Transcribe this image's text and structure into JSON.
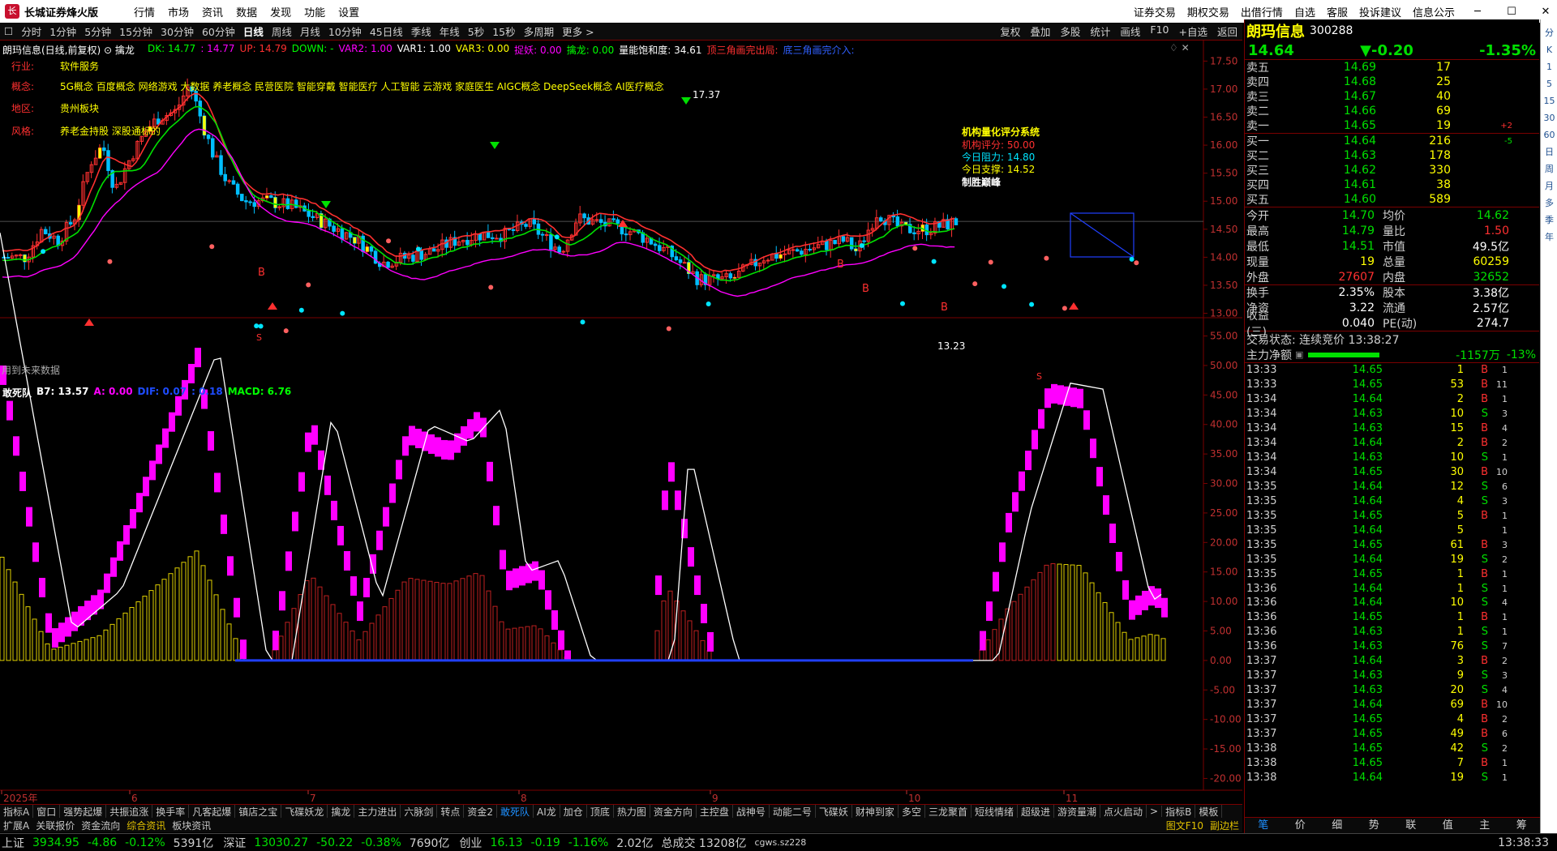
{
  "app": {
    "title": "长城证券烽火版",
    "menu": [
      "行情",
      "市场",
      "资讯",
      "数据",
      "发现",
      "功能",
      "设置"
    ],
    "right_menu": [
      "证券交易",
      "期权交易",
      "出借行情",
      "自选",
      "客服",
      "投诉建议",
      "信息公示"
    ]
  },
  "periods": [
    "分时",
    "1分钟",
    "5分钟",
    "15分钟",
    "30分钟",
    "60分钟",
    "日线",
    "周线",
    "月线",
    "10分钟",
    "45日线",
    "季线",
    "年线",
    "5秒",
    "15秒",
    "多周期",
    "更多 >"
  ],
  "active_period": "日线",
  "toolbar": [
    "复权",
    "叠加",
    "多股",
    "统计",
    "画线",
    "F10",
    "+自选",
    "返回"
  ],
  "main_indicator": {
    "name_line": "朗玛信息(日线,前复权) ⊙ 擒龙",
    "vals": [
      {
        "t": "DK: 14.77",
        "c": "#00ff00"
      },
      {
        "t": ": 14.77",
        "c": "#ff00ff"
      },
      {
        "t": "UP: 14.79",
        "c": "#ff3030"
      },
      {
        "t": "DOWN: -",
        "c": "#00ff00"
      },
      {
        "t": "VAR2: 1.00",
        "c": "#ff00ff"
      },
      {
        "t": "VAR1: 1.00",
        "c": "#ffffff"
      },
      {
        "t": "VAR3: 0.00",
        "c": "#ffff00"
      },
      {
        "t": "捉妖: 0.00",
        "c": "#ff00ff"
      },
      {
        "t": "擒龙: 0.00",
        "c": "#00ff00"
      },
      {
        "t": "量能饱和度: 34.61",
        "c": "#ffffff"
      },
      {
        "t": "顶三角画完出局:",
        "c": "#ff3030"
      },
      {
        "t": "底三角画完介入:",
        "c": "#3060ff"
      }
    ]
  },
  "info": {
    "industry_label": "行业:",
    "industry": "软件服务",
    "concept_label": "概念:",
    "concepts": "5G概念 百度概念 网络游戏 大数据 养老概念 民营医院 智能穿戴 智能医疗 人工智能 云游戏 家庭医生 AIGC概念 DeepSeek概念 AI医疗概念",
    "region_label": "地区:",
    "region": "贵州板块",
    "style_label": "风格:",
    "style": "养老金持股 深股通标的"
  },
  "quant": {
    "title": "机构量化评分系统",
    "score": "机构评分: 50.00",
    "resist": "今日阻力: 14.80",
    "support": "今日支撑: 14.52",
    "note": "制胜巅峰"
  },
  "price_labels": {
    "high": "17.37",
    "low": "13.23"
  },
  "future_note": "用到未来数据",
  "y_axis_main": [
    "17.50",
    "17.00",
    "16.50",
    "16.00",
    "15.50",
    "15.00",
    "14.50",
    "14.00",
    "13.50",
    "13.00"
  ],
  "sub_indicator": {
    "vals": [
      {
        "t": "敢死队",
        "c": "#ffffff"
      },
      {
        "t": "B7: 13.57",
        "c": "#ffffff"
      },
      {
        "t": "A: 0.00",
        "c": "#ff00ff"
      },
      {
        "t": "DIF: 0.07",
        "c": "#1e4cff"
      },
      {
        "t": ": 0.18",
        "c": "#1e4cff"
      },
      {
        "t": "MACD: 6.76",
        "c": "#00ff00"
      }
    ]
  },
  "y_axis_sub": [
    "55.00",
    "50.00",
    "45.00",
    "40.00",
    "35.00",
    "30.00",
    "25.00",
    "20.00",
    "15.00",
    "10.00",
    "5.00",
    "0.00",
    "-5.00",
    "-10.00",
    "-15.00",
    "-20.00"
  ],
  "x_axis": [
    {
      "t": "2025年"
    },
    {
      "t": "6"
    },
    {
      "t": "7"
    },
    {
      "t": "8"
    },
    {
      "t": "9"
    },
    {
      "t": "10"
    },
    {
      "t": "11"
    }
  ],
  "x_axis_right": "日线",
  "bottom_tabs": [
    "指标A",
    "窗口",
    "强势起爆",
    "共振追涨",
    "换手率",
    "凡客起爆",
    "镇店之宝",
    "飞碟妖龙",
    "擒龙",
    "主力进出",
    "六脉剑",
    "转点",
    "资金2",
    "敢死队",
    "AI龙",
    "加仓",
    "顶底",
    "热力图",
    "资金方向",
    "主控盘",
    "战神号",
    "动能二号",
    "飞碟妖",
    "财神到家",
    "多空",
    "三龙聚首",
    "短线情绪",
    "超级进",
    "游资量潮",
    "点火启动",
    ">",
    "指标B",
    "模板"
  ],
  "active_bottom_tab": "敢死队",
  "bottom_tabs2": [
    "扩展A",
    "关联报价",
    "资金流向",
    "综合资讯",
    "板块资讯"
  ],
  "bottom_tabs2_right": [
    "图文F10",
    "副边栏"
  ],
  "stock": {
    "name": "朗玛信息",
    "code": "300288",
    "price": "14.64",
    "change": "▼-0.20",
    "pct": "-1.35%"
  },
  "orderbook": {
    "asks": [
      {
        "l": "卖五",
        "p": "14.69",
        "v": "17",
        "c": ""
      },
      {
        "l": "卖四",
        "p": "14.68",
        "v": "25",
        "c": ""
      },
      {
        "l": "卖三",
        "p": "14.67",
        "v": "40",
        "c": ""
      },
      {
        "l": "卖二",
        "p": "14.66",
        "v": "69",
        "c": ""
      },
      {
        "l": "卖一",
        "p": "14.65",
        "v": "19",
        "c": "+2"
      }
    ],
    "bids": [
      {
        "l": "买一",
        "p": "14.64",
        "v": "216",
        "c": "-5"
      },
      {
        "l": "买二",
        "p": "14.63",
        "v": "178",
        "c": ""
      },
      {
        "l": "买三",
        "p": "14.62",
        "v": "330",
        "c": ""
      },
      {
        "l": "买四",
        "p": "14.61",
        "v": "38",
        "c": ""
      },
      {
        "l": "买五",
        "p": "14.60",
        "v": "589",
        "c": ""
      }
    ]
  },
  "stats": [
    {
      "k": "今开",
      "v": "14.70",
      "vc": "#00e000",
      "k2": "均价",
      "v2": "14.62",
      "v2c": "#00e000"
    },
    {
      "k": "最高",
      "v": "14.79",
      "vc": "#00e000",
      "k2": "量比",
      "v2": "1.50",
      "v2c": "#ff3030"
    },
    {
      "k": "最低",
      "v": "14.51",
      "vc": "#00e000",
      "k2": "市值",
      "v2": "49.5亿",
      "v2c": "#ffffff"
    },
    {
      "k": "现量",
      "v": "19",
      "vc": "#ffff00",
      "k2": "总量",
      "v2": "60259",
      "v2c": "#ffff00"
    },
    {
      "k": "外盘",
      "v": "27607",
      "vc": "#ff3030",
      "k2": "内盘",
      "v2": "32652",
      "v2c": "#00e000"
    },
    {
      "k": "换手",
      "v": "2.35%",
      "vc": "#ffffff",
      "k2": "股本",
      "v2": "3.38亿",
      "v2c": "#ffffff"
    },
    {
      "k": "净资",
      "v": "3.22",
      "vc": "#ffffff",
      "k2": "流通",
      "v2": "2.57亿",
      "v2c": "#ffffff"
    },
    {
      "k": "收益(三)",
      "v": "0.040",
      "vc": "#ffffff",
      "k2": "PE(动)",
      "v2": "274.7",
      "v2c": "#ffffff"
    }
  ],
  "trade_status": "交易状态: 连续竞价 13:38:27",
  "main_flow": {
    "label": "主力净额",
    "value": "-1157万",
    "pct": "-13%"
  },
  "ticks": [
    {
      "t": "13:33",
      "p": "14.65",
      "v": "1",
      "s": "B",
      "n": "1"
    },
    {
      "t": "13:33",
      "p": "14.65",
      "v": "53",
      "s": "B",
      "n": "11"
    },
    {
      "t": "13:34",
      "p": "14.64",
      "v": "2",
      "s": "B",
      "n": "1"
    },
    {
      "t": "13:34",
      "p": "14.63",
      "v": "10",
      "s": "S",
      "n": "3"
    },
    {
      "t": "13:34",
      "p": "14.63",
      "v": "15",
      "s": "B",
      "n": "4"
    },
    {
      "t": "13:34",
      "p": "14.64",
      "v": "2",
      "s": "B",
      "n": "2"
    },
    {
      "t": "13:34",
      "p": "14.63",
      "v": "10",
      "s": "S",
      "n": "1"
    },
    {
      "t": "13:34",
      "p": "14.65",
      "v": "30",
      "s": "B",
      "n": "10"
    },
    {
      "t": "13:35",
      "p": "14.64",
      "v": "12",
      "s": "S",
      "n": "6"
    },
    {
      "t": "13:35",
      "p": "14.64",
      "v": "4",
      "s": "S",
      "n": "3"
    },
    {
      "t": "13:35",
      "p": "14.65",
      "v": "5",
      "s": "B",
      "n": "1"
    },
    {
      "t": "13:35",
      "p": "14.64",
      "v": "5",
      "s": "",
      "n": "1"
    },
    {
      "t": "13:35",
      "p": "14.65",
      "v": "61",
      "s": "B",
      "n": "3"
    },
    {
      "t": "13:35",
      "p": "14.64",
      "v": "19",
      "s": "S",
      "n": "2"
    },
    {
      "t": "13:35",
      "p": "14.65",
      "v": "1",
      "s": "B",
      "n": "1"
    },
    {
      "t": "13:36",
      "p": "14.64",
      "v": "1",
      "s": "S",
      "n": "1"
    },
    {
      "t": "13:36",
      "p": "14.64",
      "v": "10",
      "s": "S",
      "n": "4"
    },
    {
      "t": "13:36",
      "p": "14.65",
      "v": "1",
      "s": "B",
      "n": "1"
    },
    {
      "t": "13:36",
      "p": "14.63",
      "v": "1",
      "s": "S",
      "n": "1"
    },
    {
      "t": "13:36",
      "p": "14.63",
      "v": "76",
      "s": "S",
      "n": "7"
    },
    {
      "t": "13:37",
      "p": "14.64",
      "v": "3",
      "s": "B",
      "n": "2"
    },
    {
      "t": "13:37",
      "p": "14.63",
      "v": "9",
      "s": "S",
      "n": "3"
    },
    {
      "t": "13:37",
      "p": "14.63",
      "v": "20",
      "s": "S",
      "n": "4"
    },
    {
      "t": "13:37",
      "p": "14.64",
      "v": "69",
      "s": "B",
      "n": "10"
    },
    {
      "t": "13:37",
      "p": "14.65",
      "v": "4",
      "s": "B",
      "n": "2"
    },
    {
      "t": "13:37",
      "p": "14.65",
      "v": "49",
      "s": "B",
      "n": "6"
    },
    {
      "t": "13:38",
      "p": "14.65",
      "v": "42",
      "s": "S",
      "n": "2"
    },
    {
      "t": "13:38",
      "p": "14.65",
      "v": "7",
      "s": "B",
      "n": "1"
    },
    {
      "t": "13:38",
      "p": "14.64",
      "v": "19",
      "s": "S",
      "n": "1"
    }
  ],
  "right_tabs": [
    "笔",
    "价",
    "细",
    "势",
    "联",
    "值",
    "主",
    "筹"
  ],
  "side_icons": [
    "分",
    "K",
    "1",
    "5",
    "15",
    "30",
    "60",
    "日",
    "周",
    "月",
    "多",
    "季",
    "年"
  ],
  "statusbar": {
    "sh": [
      {
        "t": "上证",
        "c": "#d0d0d0"
      },
      {
        "t": "3934.95",
        "c": "#00e000"
      },
      {
        "t": "-4.86",
        "c": "#00e000"
      },
      {
        "t": "-0.12%",
        "c": "#00e000"
      },
      {
        "t": "5391亿",
        "c": "#d0d0d0"
      }
    ],
    "sz": [
      {
        "t": "深证",
        "c": "#d0d0d0"
      },
      {
        "t": "13030.27",
        "c": "#00e000"
      },
      {
        "t": "-50.22",
        "c": "#00e000"
      },
      {
        "t": "-0.38%",
        "c": "#00e000"
      },
      {
        "t": "7690亿",
        "c": "#d0d0d0"
      }
    ],
    "cy": [
      {
        "t": "创业",
        "c": "#d0d0d0"
      },
      {
        "t": "16.13",
        "c": "#00e000"
      },
      {
        "t": "-0.19",
        "c": "#00e000"
      },
      {
        "t": "-1.16%",
        "c": "#00e000"
      },
      {
        "t": "2.02亿",
        "c": "#d0d0d0"
      }
    ],
    "total": "总成交 13208亿",
    "server": "cgws.sz228",
    "time": "13:38:33"
  },
  "colors": {
    "up": "#ff3030",
    "down": "#00e000",
    "accent": "#1e90ff",
    "border": "#7a0000"
  }
}
